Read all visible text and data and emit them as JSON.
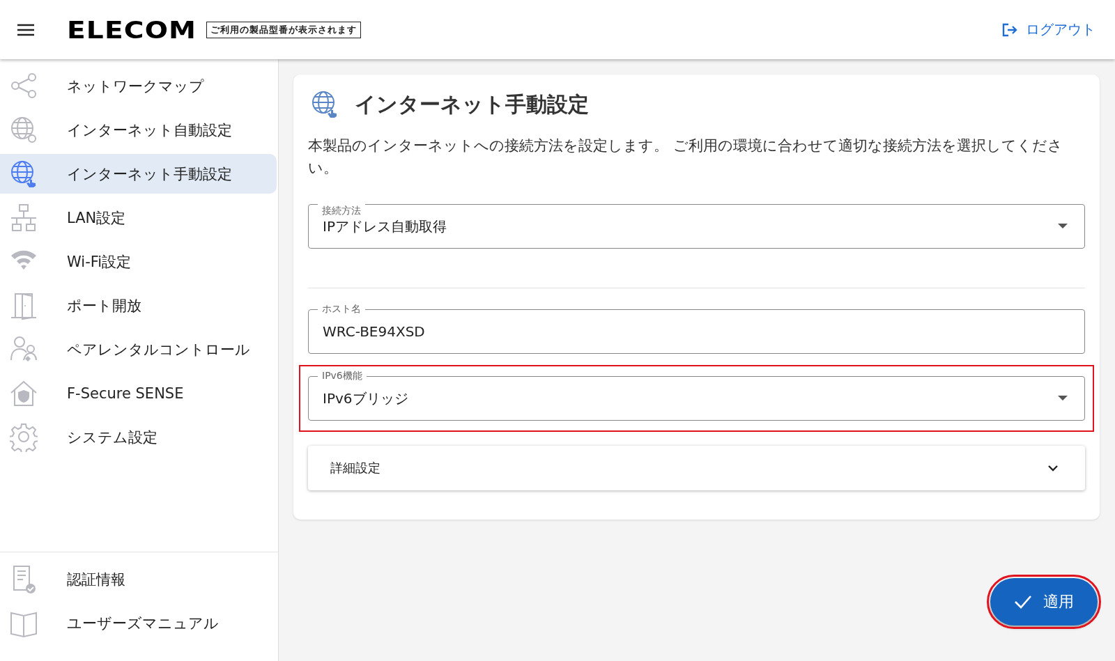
{
  "header": {
    "logo": "ELECOM",
    "model_label": "ご利用の製品型番が表示されます",
    "logout": "ログアウト"
  },
  "sidebar": {
    "items": [
      {
        "label": "ネットワークマップ",
        "selected": false
      },
      {
        "label": "インターネット自動設定",
        "selected": false
      },
      {
        "label": "インターネット手動設定",
        "selected": true
      },
      {
        "label": "LAN設定",
        "selected": false
      },
      {
        "label": "Wi-Fi設定",
        "selected": false
      },
      {
        "label": "ポート開放",
        "selected": false
      },
      {
        "label": "ペアレンタルコントロール",
        "selected": false
      },
      {
        "label": "F-Secure SENSE",
        "selected": false
      },
      {
        "label": "システム設定",
        "selected": false
      }
    ],
    "bottom_items": [
      {
        "label": "認証情報",
        "selected": false
      },
      {
        "label": "ユーザーズマニュアル",
        "selected": false
      }
    ]
  },
  "card": {
    "title": "インターネット手動設定",
    "description": "本製品のインターネットへの接続方法を設定します。 ご利用の環境に合わせて適切な接続方法を選択してください。",
    "fields": [
      {
        "kind": "select",
        "label": "接続方法",
        "value": "IPアドレス自動取得",
        "highlighted": false
      },
      {
        "kind": "divider"
      },
      {
        "kind": "text",
        "label": "ホスト名",
        "value": "WRC-BE94XSD",
        "highlighted": false
      },
      {
        "kind": "select",
        "label": "IPv6機能",
        "value": "IPv6ブリッジ",
        "highlighted": true
      }
    ],
    "accordion": {
      "label": "詳細設定",
      "expanded": false
    }
  },
  "apply_button": {
    "label": "適用",
    "highlighted": true
  }
}
